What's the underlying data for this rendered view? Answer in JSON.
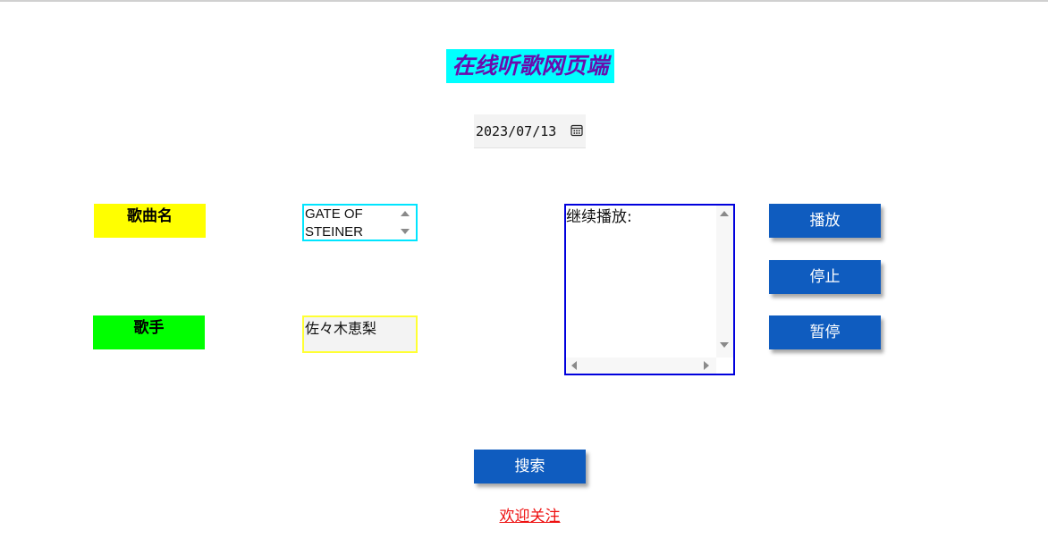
{
  "page": {
    "title": "在线听歌网页端"
  },
  "date_field": {
    "value": "2023/07/13",
    "icon": "calendar-icon"
  },
  "song": {
    "label": "歌曲名",
    "selected_value": "GATE OF STEINER"
  },
  "singer": {
    "label": "歌手",
    "value": "佐々木恵梨"
  },
  "player": {
    "textarea_value": "继续播放:"
  },
  "controls": {
    "play_label": "播放",
    "stop_label": "停止",
    "pause_label": "暂停"
  },
  "search": {
    "button_label": "搜索"
  },
  "footer": {
    "welcome_link": "欢迎关注"
  },
  "colors": {
    "title_bg": "#00ffff",
    "title_text": "#6a0dad",
    "song_label_bg": "#ffff00",
    "singer_label_bg": "#00ff00",
    "song_select_border": "#00e5ff",
    "singer_input_border": "#ffff33",
    "player_border": "#0000dd",
    "button_bg": "#0f5cbf",
    "link_color": "#ee1111"
  }
}
